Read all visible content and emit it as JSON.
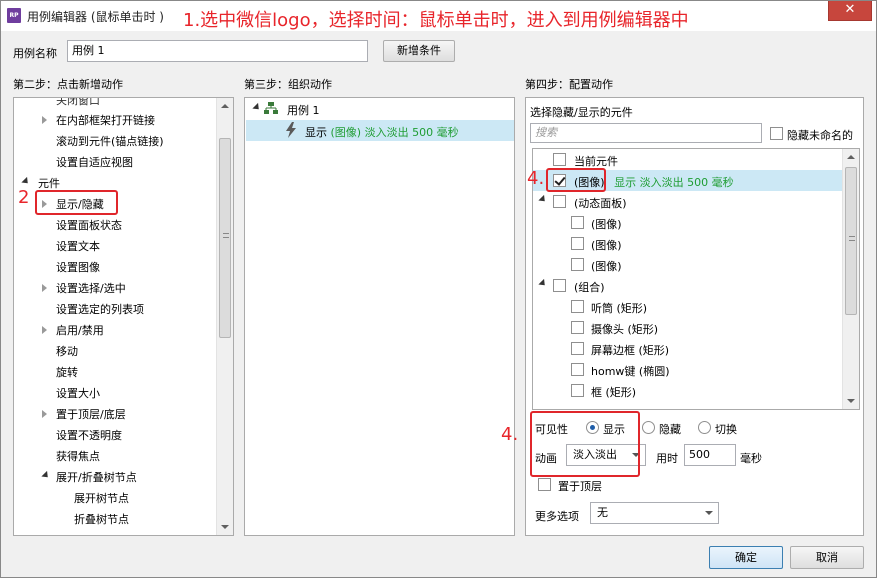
{
  "window": {
    "app_icon": "RP",
    "title": "用例编辑器 (鼠标单击时 )",
    "annotation": "1.选中微信logo，选择时间：鼠标单击时，进入到用例编辑器中",
    "close_label": "✕"
  },
  "top": {
    "case_name_label": "用例名称",
    "case_name_value": "用例 1",
    "add_condition_label": "新增条件"
  },
  "step2": {
    "heading": "第二步：点击新增动作",
    "partial_top": "关闭窗口",
    "items": [
      {
        "label": "在内部框架打开链接",
        "expandable": true
      },
      {
        "label": "滚动到元件(锚点链接)",
        "expandable": false
      },
      {
        "label": "设置自适应视图",
        "expandable": false
      }
    ],
    "section_label": "元件",
    "section_items": [
      {
        "label": "显示/隐藏",
        "expandable": true
      },
      {
        "label": "设置面板状态",
        "expandable": false
      },
      {
        "label": "设置文本",
        "expandable": false
      },
      {
        "label": "设置图像",
        "expandable": false
      },
      {
        "label": "设置选择/选中",
        "expandable": true
      },
      {
        "label": "设置选定的列表项",
        "expandable": false
      },
      {
        "label": "启用/禁用",
        "expandable": true
      },
      {
        "label": "移动",
        "expandable": false
      },
      {
        "label": "旋转",
        "expandable": false
      },
      {
        "label": "设置大小",
        "expandable": false
      },
      {
        "label": "置于顶层/底层",
        "expandable": true
      },
      {
        "label": "设置不透明度",
        "expandable": false
      },
      {
        "label": "获得焦点",
        "expandable": false
      },
      {
        "label": "展开/折叠树节点",
        "expandable": true,
        "expanded": true
      }
    ],
    "tree_sub_items": [
      "展开树节点",
      "折叠树节点"
    ],
    "annotation_number": "2"
  },
  "step3": {
    "heading": "第三步：组织动作",
    "case_label": "用例 1",
    "action_prefix": "显示",
    "action_detail": "(图像) 淡入淡出 500 毫秒"
  },
  "step4": {
    "heading": "第四步：配置动作",
    "subheading": "选择隐藏/显示的元件",
    "search_placeholder": "搜索",
    "hide_unnamed_label": "隐藏未命名的",
    "annotation_number": "4.",
    "tree": {
      "current_widget": "当前元件",
      "selected_item": "(图像)",
      "selected_item_action": "显示 淡入淡出 500 毫秒",
      "dynamic_panel": "(动态面板)",
      "dynamic_children": [
        "(图像)",
        "(图像)",
        "(图像)"
      ],
      "group": "(组合)",
      "group_children": [
        "听筒 (矩形)",
        "摄像头 (矩形)",
        "屏幕边框 (矩形)",
        "homw键 (椭圆)",
        "框 (矩形)"
      ]
    },
    "visibility": {
      "label": "可见性",
      "options": [
        "显示",
        "隐藏",
        "切换"
      ],
      "selected": "显示"
    },
    "animation": {
      "label": "动画",
      "value": "淡入淡出",
      "time_label": "用时",
      "time_value": "500",
      "unit": "毫秒"
    },
    "bring_front_label": "置于顶层",
    "more_options_label": "更多选项",
    "more_options_value": "无"
  },
  "footer": {
    "ok_label": "确定",
    "cancel_label": "取消"
  },
  "colors": {
    "annotation_red": "#e8252b",
    "action_green": "#1f9d33",
    "selection_blue": "#cce8f5"
  }
}
